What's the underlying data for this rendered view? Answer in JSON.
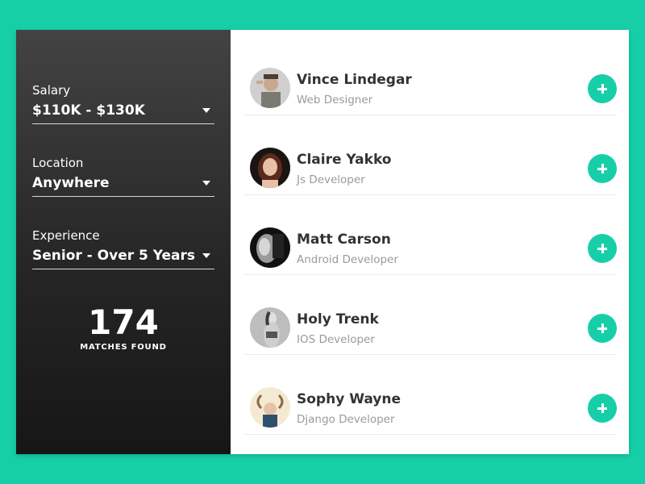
{
  "filters": {
    "salary": {
      "label": "Salary",
      "value": "$110K - $130K"
    },
    "location": {
      "label": "Location",
      "value": "Anywhere"
    },
    "experience": {
      "label": "Experience",
      "value": "Senior - Over 5 Years"
    }
  },
  "results": {
    "count": "174",
    "label": "MATCHES FOUND"
  },
  "people": [
    {
      "name": "Vince Lindegar",
      "role": "Web Designer"
    },
    {
      "name": "Claire Yakko",
      "role": "Js Developer"
    },
    {
      "name": "Matt Carson",
      "role": "Android Developer"
    },
    {
      "name": "Holy Trenk",
      "role": "IOS Developer"
    },
    {
      "name": "Sophy Wayne",
      "role": "Django Developer"
    }
  ],
  "colors": {
    "accent": "#16cfa8",
    "sidebar_top": "#434343",
    "sidebar_bottom": "#161616"
  },
  "icons": {
    "add": "plus-icon",
    "dropdown": "caret-down-icon"
  }
}
